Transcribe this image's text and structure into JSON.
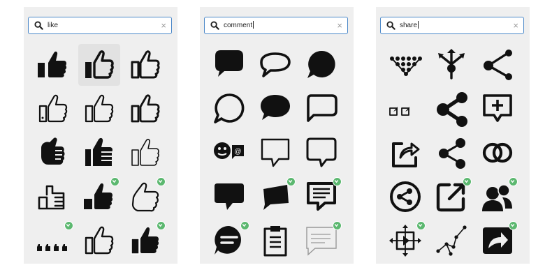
{
  "panels": [
    {
      "query": "like",
      "cursor": false,
      "icons": [
        {
          "name": "thumbs-up-solid-icon",
          "badge": false,
          "selected": false
        },
        {
          "name": "thumbs-up-bold-outline-icon",
          "badge": false,
          "selected": true
        },
        {
          "name": "thumbs-up-outline-icon",
          "badge": false,
          "selected": false
        },
        {
          "name": "thumbs-up-outline-cuff-icon",
          "badge": false,
          "selected": false
        },
        {
          "name": "thumbs-up-thin-outline-icon",
          "badge": false,
          "selected": false
        },
        {
          "name": "thumbs-up-outline-alt-icon",
          "badge": false,
          "selected": false
        },
        {
          "name": "thumbs-up-fist-icon",
          "badge": false,
          "selected": false
        },
        {
          "name": "thumbs-up-striped-icon",
          "badge": false,
          "selected": false
        },
        {
          "name": "thumbs-up-sketch-icon",
          "badge": false,
          "selected": false
        },
        {
          "name": "thumbs-up-square-outline-icon",
          "badge": false,
          "selected": false
        },
        {
          "name": "thumbs-up-dark-icon",
          "badge": true,
          "selected": false
        },
        {
          "name": "thumbs-up-line-icon",
          "badge": true,
          "selected": false
        },
        {
          "name": "thumbs-up-row-icon",
          "badge": true,
          "selected": false
        },
        {
          "name": "thumbs-up-cuff-outline-icon",
          "badge": false,
          "selected": false
        },
        {
          "name": "thumbs-up-solid-cuff-icon",
          "badge": true,
          "selected": false
        }
      ]
    },
    {
      "query": "comment",
      "cursor": true,
      "icons": [
        {
          "name": "speech-bubble-solid-icon",
          "badge": false,
          "selected": false
        },
        {
          "name": "speech-bubble-outline-icon",
          "badge": false,
          "selected": false
        },
        {
          "name": "speech-bubble-round-solid-icon",
          "badge": false,
          "selected": false
        },
        {
          "name": "speech-bubble-round-outline-icon",
          "badge": false,
          "selected": false
        },
        {
          "name": "speech-bubble-oval-solid-icon",
          "badge": false,
          "selected": false
        },
        {
          "name": "speech-bubble-rounded-outline-icon",
          "badge": false,
          "selected": false
        },
        {
          "name": "chat-smiley-icon",
          "badge": false,
          "selected": false
        },
        {
          "name": "comment-square-outline-icon",
          "badge": false,
          "selected": false
        },
        {
          "name": "comment-rounded-outline-icon",
          "badge": false,
          "selected": false
        },
        {
          "name": "comment-square-solid-icon",
          "badge": false,
          "selected": false
        },
        {
          "name": "comment-tilted-solid-icon",
          "badge": true,
          "selected": false
        },
        {
          "name": "comment-lines-icon",
          "badge": true,
          "selected": false
        },
        {
          "name": "comment-circle-lines-icon",
          "badge": true,
          "selected": false
        },
        {
          "name": "clipboard-list-icon",
          "badge": false,
          "selected": false
        },
        {
          "name": "comment-thin-lines-icon",
          "badge": true,
          "selected": false
        }
      ]
    },
    {
      "query": "share",
      "cursor": true,
      "icons": [
        {
          "name": "share-network-dots-icon",
          "badge": false,
          "selected": false
        },
        {
          "name": "share-arrows-out-icon",
          "badge": false,
          "selected": false
        },
        {
          "name": "share-nodes-icon",
          "badge": false,
          "selected": false
        },
        {
          "name": "share-small-squares-icon",
          "badge": false,
          "selected": false
        },
        {
          "name": "share-bold-icon",
          "badge": false,
          "selected": false
        },
        {
          "name": "share-plus-bubble-icon",
          "badge": false,
          "selected": false
        },
        {
          "name": "share-box-arrow-icon",
          "badge": false,
          "selected": false
        },
        {
          "name": "share-alt-icon",
          "badge": false,
          "selected": false
        },
        {
          "name": "share-rings-icon",
          "badge": false,
          "selected": false
        },
        {
          "name": "share-circle-icon",
          "badge": false,
          "selected": false
        },
        {
          "name": "external-link-square-icon",
          "badge": true,
          "selected": false
        },
        {
          "name": "share-users-icon",
          "badge": true,
          "selected": false
        },
        {
          "name": "share-media-icon",
          "badge": true,
          "selected": false
        },
        {
          "name": "share-graph-icon",
          "badge": false,
          "selected": false
        },
        {
          "name": "share-square-arrow-icon",
          "badge": true,
          "selected": false
        }
      ]
    }
  ],
  "colors": {
    "panel": "#efefef",
    "search_border": "#4a87c8",
    "badge": "#5cb870",
    "icon": "#111111",
    "selected_bg": "#e2e2e2"
  }
}
